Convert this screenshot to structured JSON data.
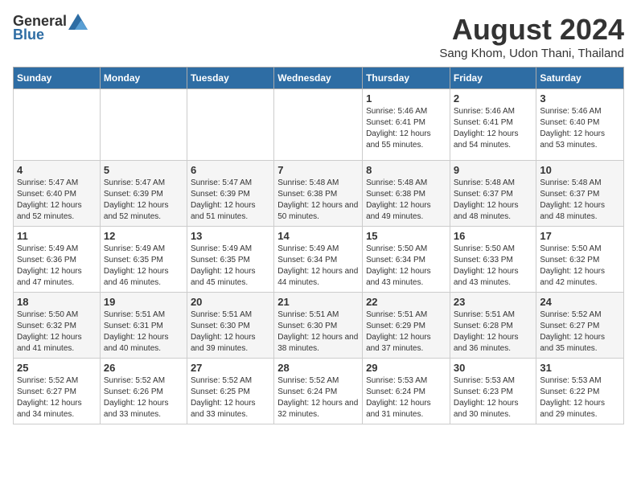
{
  "logo": {
    "general": "General",
    "blue": "Blue"
  },
  "title": "August 2024",
  "subtitle": "Sang Khom, Udon Thani, Thailand",
  "days_of_week": [
    "Sunday",
    "Monday",
    "Tuesday",
    "Wednesday",
    "Thursday",
    "Friday",
    "Saturday"
  ],
  "weeks": [
    [
      {
        "day": "",
        "info": ""
      },
      {
        "day": "",
        "info": ""
      },
      {
        "day": "",
        "info": ""
      },
      {
        "day": "",
        "info": ""
      },
      {
        "day": "1",
        "sunrise": "5:46 AM",
        "sunset": "6:41 PM",
        "daylight": "12 hours and 55 minutes."
      },
      {
        "day": "2",
        "sunrise": "5:46 AM",
        "sunset": "6:41 PM",
        "daylight": "12 hours and 54 minutes."
      },
      {
        "day": "3",
        "sunrise": "5:46 AM",
        "sunset": "6:40 PM",
        "daylight": "12 hours and 53 minutes."
      }
    ],
    [
      {
        "day": "4",
        "sunrise": "5:47 AM",
        "sunset": "6:40 PM",
        "daylight": "12 hours and 52 minutes."
      },
      {
        "day": "5",
        "sunrise": "5:47 AM",
        "sunset": "6:39 PM",
        "daylight": "12 hours and 52 minutes."
      },
      {
        "day": "6",
        "sunrise": "5:47 AM",
        "sunset": "6:39 PM",
        "daylight": "12 hours and 51 minutes."
      },
      {
        "day": "7",
        "sunrise": "5:48 AM",
        "sunset": "6:38 PM",
        "daylight": "12 hours and 50 minutes."
      },
      {
        "day": "8",
        "sunrise": "5:48 AM",
        "sunset": "6:38 PM",
        "daylight": "12 hours and 49 minutes."
      },
      {
        "day": "9",
        "sunrise": "5:48 AM",
        "sunset": "6:37 PM",
        "daylight": "12 hours and 48 minutes."
      },
      {
        "day": "10",
        "sunrise": "5:48 AM",
        "sunset": "6:37 PM",
        "daylight": "12 hours and 48 minutes."
      }
    ],
    [
      {
        "day": "11",
        "sunrise": "5:49 AM",
        "sunset": "6:36 PM",
        "daylight": "12 hours and 47 minutes."
      },
      {
        "day": "12",
        "sunrise": "5:49 AM",
        "sunset": "6:35 PM",
        "daylight": "12 hours and 46 minutes."
      },
      {
        "day": "13",
        "sunrise": "5:49 AM",
        "sunset": "6:35 PM",
        "daylight": "12 hours and 45 minutes."
      },
      {
        "day": "14",
        "sunrise": "5:49 AM",
        "sunset": "6:34 PM",
        "daylight": "12 hours and 44 minutes."
      },
      {
        "day": "15",
        "sunrise": "5:50 AM",
        "sunset": "6:34 PM",
        "daylight": "12 hours and 43 minutes."
      },
      {
        "day": "16",
        "sunrise": "5:50 AM",
        "sunset": "6:33 PM",
        "daylight": "12 hours and 43 minutes."
      },
      {
        "day": "17",
        "sunrise": "5:50 AM",
        "sunset": "6:32 PM",
        "daylight": "12 hours and 42 minutes."
      }
    ],
    [
      {
        "day": "18",
        "sunrise": "5:50 AM",
        "sunset": "6:32 PM",
        "daylight": "12 hours and 41 minutes."
      },
      {
        "day": "19",
        "sunrise": "5:51 AM",
        "sunset": "6:31 PM",
        "daylight": "12 hours and 40 minutes."
      },
      {
        "day": "20",
        "sunrise": "5:51 AM",
        "sunset": "6:30 PM",
        "daylight": "12 hours and 39 minutes."
      },
      {
        "day": "21",
        "sunrise": "5:51 AM",
        "sunset": "6:30 PM",
        "daylight": "12 hours and 38 minutes."
      },
      {
        "day": "22",
        "sunrise": "5:51 AM",
        "sunset": "6:29 PM",
        "daylight": "12 hours and 37 minutes."
      },
      {
        "day": "23",
        "sunrise": "5:51 AM",
        "sunset": "6:28 PM",
        "daylight": "12 hours and 36 minutes."
      },
      {
        "day": "24",
        "sunrise": "5:52 AM",
        "sunset": "6:27 PM",
        "daylight": "12 hours and 35 minutes."
      }
    ],
    [
      {
        "day": "25",
        "sunrise": "5:52 AM",
        "sunset": "6:27 PM",
        "daylight": "12 hours and 34 minutes."
      },
      {
        "day": "26",
        "sunrise": "5:52 AM",
        "sunset": "6:26 PM",
        "daylight": "12 hours and 33 minutes."
      },
      {
        "day": "27",
        "sunrise": "5:52 AM",
        "sunset": "6:25 PM",
        "daylight": "12 hours and 33 minutes."
      },
      {
        "day": "28",
        "sunrise": "5:52 AM",
        "sunset": "6:24 PM",
        "daylight": "12 hours and 32 minutes."
      },
      {
        "day": "29",
        "sunrise": "5:53 AM",
        "sunset": "6:24 PM",
        "daylight": "12 hours and 31 minutes."
      },
      {
        "day": "30",
        "sunrise": "5:53 AM",
        "sunset": "6:23 PM",
        "daylight": "12 hours and 30 minutes."
      },
      {
        "day": "31",
        "sunrise": "5:53 AM",
        "sunset": "6:22 PM",
        "daylight": "12 hours and 29 minutes."
      }
    ]
  ],
  "labels": {
    "sunrise": "Sunrise:",
    "sunset": "Sunset:",
    "daylight": "Daylight:"
  }
}
